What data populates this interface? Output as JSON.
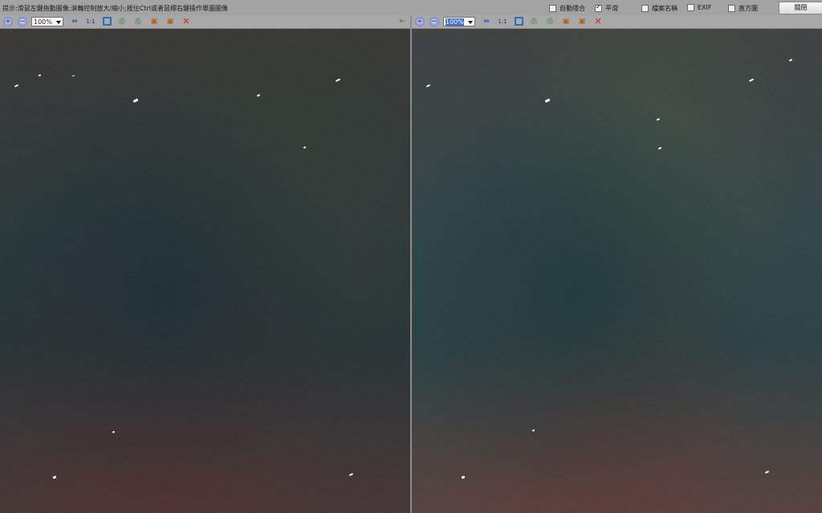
{
  "hint": "提示:滑鼠左鍵拖動圖像;滾輪控制放大/縮小;按住Ctrl或者鼠標右鍵操作單圖圖像",
  "options": [
    {
      "label": "自動隱合",
      "checked": false
    },
    {
      "label": "平滑",
      "checked": true
    },
    {
      "label": "檔案名稱",
      "checked": false
    },
    {
      "label": "EXIF",
      "checked": false
    },
    {
      "label": "直方圖",
      "checked": false
    }
  ],
  "close_label": "關閉",
  "left_pane": {
    "zoom": "100%",
    "one_to_one": "1:1"
  },
  "right_pane": {
    "zoom": "100%",
    "one_to_one": "1:1"
  },
  "icons": [
    "zoom-in-icon",
    "zoom-out-icon",
    "fit-icon",
    "actual-size-icon",
    "fit-box-icon",
    "print-icon",
    "print-alt-icon",
    "image-icon",
    "image-alt-icon",
    "delete-icon",
    "back-arrow-icon"
  ]
}
